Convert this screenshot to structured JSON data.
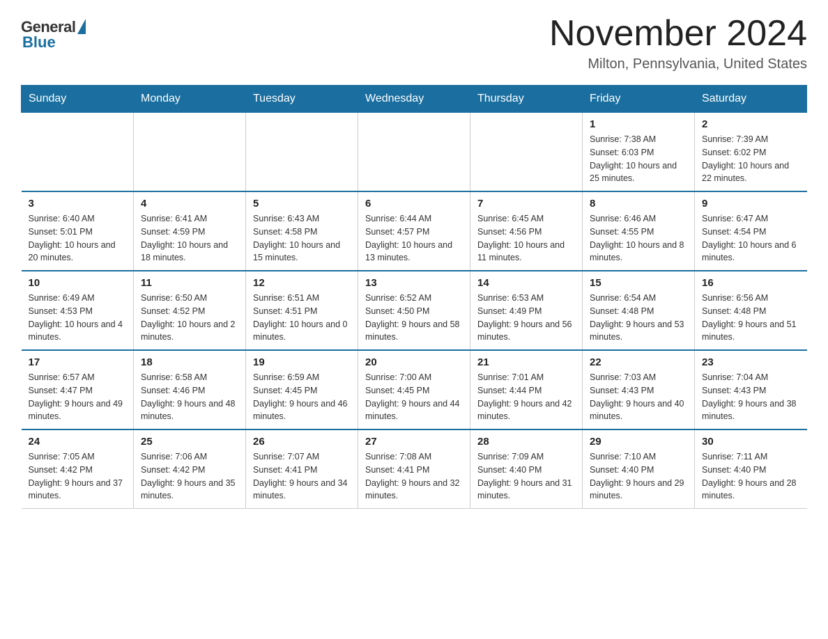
{
  "header": {
    "logo_general": "General",
    "logo_blue": "Blue",
    "month_title": "November 2024",
    "location": "Milton, Pennsylvania, United States"
  },
  "days_of_week": [
    "Sunday",
    "Monday",
    "Tuesday",
    "Wednesday",
    "Thursday",
    "Friday",
    "Saturday"
  ],
  "weeks": [
    [
      {
        "day": "",
        "info": ""
      },
      {
        "day": "",
        "info": ""
      },
      {
        "day": "",
        "info": ""
      },
      {
        "day": "",
        "info": ""
      },
      {
        "day": "",
        "info": ""
      },
      {
        "day": "1",
        "info": "Sunrise: 7:38 AM\nSunset: 6:03 PM\nDaylight: 10 hours and 25 minutes."
      },
      {
        "day": "2",
        "info": "Sunrise: 7:39 AM\nSunset: 6:02 PM\nDaylight: 10 hours and 22 minutes."
      }
    ],
    [
      {
        "day": "3",
        "info": "Sunrise: 6:40 AM\nSunset: 5:01 PM\nDaylight: 10 hours and 20 minutes."
      },
      {
        "day": "4",
        "info": "Sunrise: 6:41 AM\nSunset: 4:59 PM\nDaylight: 10 hours and 18 minutes."
      },
      {
        "day": "5",
        "info": "Sunrise: 6:43 AM\nSunset: 4:58 PM\nDaylight: 10 hours and 15 minutes."
      },
      {
        "day": "6",
        "info": "Sunrise: 6:44 AM\nSunset: 4:57 PM\nDaylight: 10 hours and 13 minutes."
      },
      {
        "day": "7",
        "info": "Sunrise: 6:45 AM\nSunset: 4:56 PM\nDaylight: 10 hours and 11 minutes."
      },
      {
        "day": "8",
        "info": "Sunrise: 6:46 AM\nSunset: 4:55 PM\nDaylight: 10 hours and 8 minutes."
      },
      {
        "day": "9",
        "info": "Sunrise: 6:47 AM\nSunset: 4:54 PM\nDaylight: 10 hours and 6 minutes."
      }
    ],
    [
      {
        "day": "10",
        "info": "Sunrise: 6:49 AM\nSunset: 4:53 PM\nDaylight: 10 hours and 4 minutes."
      },
      {
        "day": "11",
        "info": "Sunrise: 6:50 AM\nSunset: 4:52 PM\nDaylight: 10 hours and 2 minutes."
      },
      {
        "day": "12",
        "info": "Sunrise: 6:51 AM\nSunset: 4:51 PM\nDaylight: 10 hours and 0 minutes."
      },
      {
        "day": "13",
        "info": "Sunrise: 6:52 AM\nSunset: 4:50 PM\nDaylight: 9 hours and 58 minutes."
      },
      {
        "day": "14",
        "info": "Sunrise: 6:53 AM\nSunset: 4:49 PM\nDaylight: 9 hours and 56 minutes."
      },
      {
        "day": "15",
        "info": "Sunrise: 6:54 AM\nSunset: 4:48 PM\nDaylight: 9 hours and 53 minutes."
      },
      {
        "day": "16",
        "info": "Sunrise: 6:56 AM\nSunset: 4:48 PM\nDaylight: 9 hours and 51 minutes."
      }
    ],
    [
      {
        "day": "17",
        "info": "Sunrise: 6:57 AM\nSunset: 4:47 PM\nDaylight: 9 hours and 49 minutes."
      },
      {
        "day": "18",
        "info": "Sunrise: 6:58 AM\nSunset: 4:46 PM\nDaylight: 9 hours and 48 minutes."
      },
      {
        "day": "19",
        "info": "Sunrise: 6:59 AM\nSunset: 4:45 PM\nDaylight: 9 hours and 46 minutes."
      },
      {
        "day": "20",
        "info": "Sunrise: 7:00 AM\nSunset: 4:45 PM\nDaylight: 9 hours and 44 minutes."
      },
      {
        "day": "21",
        "info": "Sunrise: 7:01 AM\nSunset: 4:44 PM\nDaylight: 9 hours and 42 minutes."
      },
      {
        "day": "22",
        "info": "Sunrise: 7:03 AM\nSunset: 4:43 PM\nDaylight: 9 hours and 40 minutes."
      },
      {
        "day": "23",
        "info": "Sunrise: 7:04 AM\nSunset: 4:43 PM\nDaylight: 9 hours and 38 minutes."
      }
    ],
    [
      {
        "day": "24",
        "info": "Sunrise: 7:05 AM\nSunset: 4:42 PM\nDaylight: 9 hours and 37 minutes."
      },
      {
        "day": "25",
        "info": "Sunrise: 7:06 AM\nSunset: 4:42 PM\nDaylight: 9 hours and 35 minutes."
      },
      {
        "day": "26",
        "info": "Sunrise: 7:07 AM\nSunset: 4:41 PM\nDaylight: 9 hours and 34 minutes."
      },
      {
        "day": "27",
        "info": "Sunrise: 7:08 AM\nSunset: 4:41 PM\nDaylight: 9 hours and 32 minutes."
      },
      {
        "day": "28",
        "info": "Sunrise: 7:09 AM\nSunset: 4:40 PM\nDaylight: 9 hours and 31 minutes."
      },
      {
        "day": "29",
        "info": "Sunrise: 7:10 AM\nSunset: 4:40 PM\nDaylight: 9 hours and 29 minutes."
      },
      {
        "day": "30",
        "info": "Sunrise: 7:11 AM\nSunset: 4:40 PM\nDaylight: 9 hours and 28 minutes."
      }
    ]
  ]
}
